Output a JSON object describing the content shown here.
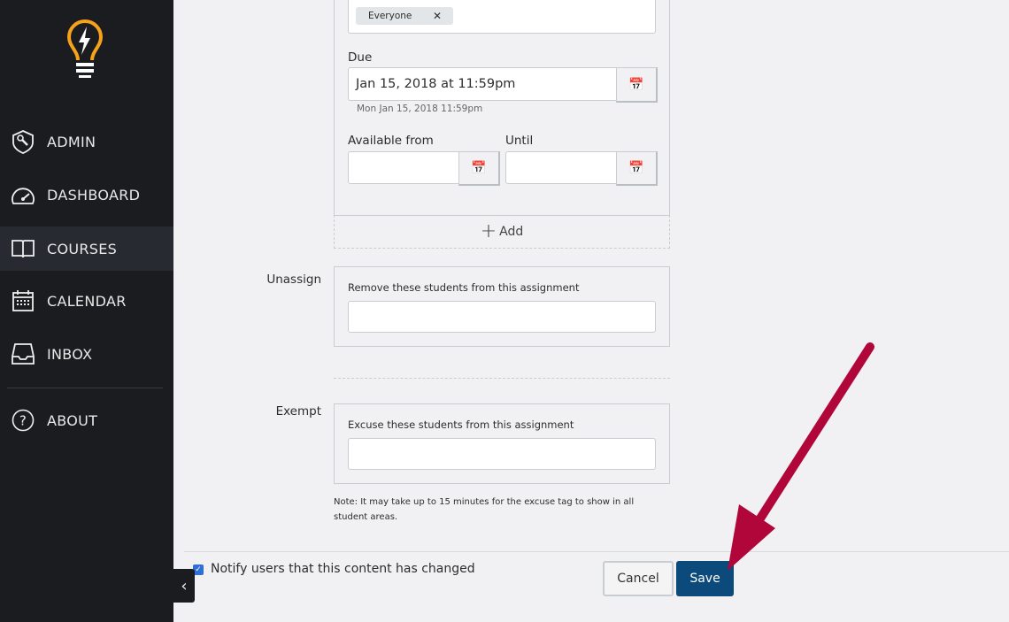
{
  "sidebar": {
    "logo": "lightbulb-logo",
    "items": [
      {
        "label": "ADMIN",
        "icon": "shield-wrench-icon"
      },
      {
        "label": "DASHBOARD",
        "icon": "speedometer-icon"
      },
      {
        "label": "COURSES",
        "icon": "open-book-icon",
        "active": true
      },
      {
        "label": "CALENDAR",
        "icon": "calendar-icon"
      },
      {
        "label": "INBOX",
        "icon": "inbox-tray-icon"
      },
      {
        "label": "ABOUT",
        "icon": "question-circle-icon"
      }
    ]
  },
  "assign": {
    "chip": "Everyone",
    "due_label": "Due",
    "due_value": "Jan 15, 2018 at 11:59pm",
    "due_hint": "Mon Jan 15, 2018 11:59pm",
    "available_label": "Available from",
    "available_value": "",
    "until_label": "Until",
    "until_value": "",
    "add_label": "Add"
  },
  "unassign": {
    "label": "Unassign",
    "description": "Remove these students from this assignment",
    "value": ""
  },
  "exempt": {
    "label": "Exempt",
    "description": "Excuse these students from this assignment",
    "value": "",
    "note": "Note: It may take up to 15 minutes for the excuse tag to show in all student areas."
  },
  "footer": {
    "notify_label": "Notify users that this content has changed",
    "notify_checked": true,
    "cancel_label": "Cancel",
    "save_label": "Save"
  },
  "colors": {
    "sidebar": "#1b1c20",
    "accent": "#f7a21b",
    "save": "#0b4a7a",
    "arrow": "#b0063a"
  }
}
